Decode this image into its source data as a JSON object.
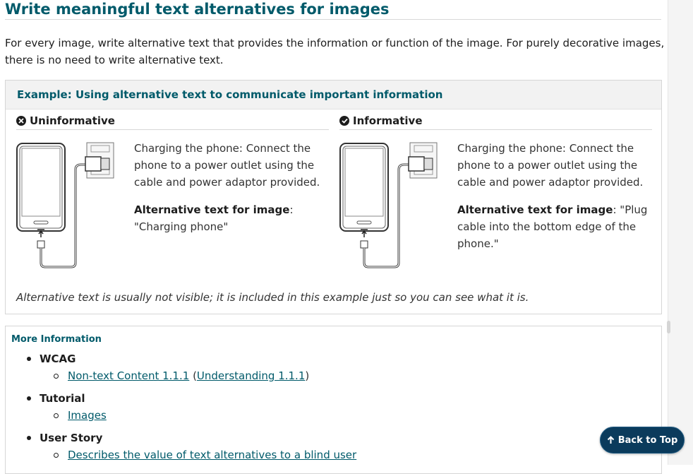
{
  "section": {
    "title": "Write meaningful text alternatives for images",
    "intro": "For every image, write alternative text that provides the information or function of the image. For purely decorative images, there is no need to write alternative text."
  },
  "example": {
    "heading": "Example: Using alternative text to communicate important information",
    "bad": {
      "icon": "x-circle-icon",
      "title": "Uninformative",
      "caption": "Charging the phone: Connect the phone to a power outlet using the cable and power adaptor provided.",
      "alt_label": "Alternative text for image",
      "alt_sep": ":",
      "alt_value": "\"Charging phone\""
    },
    "good": {
      "icon": "check-circle-icon",
      "title": "Informative",
      "caption": "Charging the phone: Connect the phone to a power outlet using the cable and power adaptor provided.",
      "alt_label": "Alternative text for image",
      "alt_sep": ":",
      "alt_value": "\"Plug cable into the bottom edge of the phone.\""
    },
    "note": "Alternative text is usually not visible; it is included in this example just so you can see what it is."
  },
  "more_info": {
    "title": "More Information",
    "groups": [
      {
        "label": "WCAG",
        "link1": "Non-text Content 1.1.1",
        "open": "(",
        "link2": "Understanding 1.1.1",
        "close": ")"
      },
      {
        "label": "Tutorial",
        "link1": "Images"
      },
      {
        "label": "User Story",
        "link1": "Describes the value of text alternatives to a blind user"
      }
    ]
  },
  "back_to_top": {
    "label": "Back to Top",
    "icon": "arrow-up-icon"
  },
  "colors": {
    "accent": "#005a6a",
    "button_bg": "#0b3b5c",
    "panel_bg": "#f2f2f2"
  }
}
